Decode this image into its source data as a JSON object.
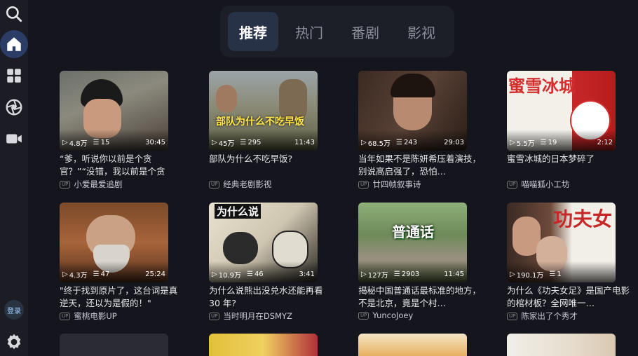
{
  "tabs": [
    {
      "label": "推荐",
      "active": true
    },
    {
      "label": "热门",
      "active": false
    },
    {
      "label": "番剧",
      "active": false
    },
    {
      "label": "影视",
      "active": false
    }
  ],
  "sidebar": {
    "login_label": "登录",
    "items": [
      "search-icon",
      "home-icon",
      "grid-icon",
      "aperture-icon",
      "video-icon"
    ]
  },
  "cards": [
    {
      "views": "4.8万",
      "danmaku": "15",
      "duration": "30:45",
      "title": "“爹，听说你以前是个贪官？”“没错，我以前是个贪官，…",
      "uploader": "小爱最爱追剧",
      "thumb_text": ""
    },
    {
      "views": "45万",
      "danmaku": "295",
      "duration": "11:43",
      "title": "部队为什么不吃早饭?",
      "uploader": "经典老剧影视",
      "thumb_text": "部队为什么不吃早饭"
    },
    {
      "views": "68.5万",
      "danmaku": "243",
      "duration": "29:03",
      "title": "当年如果不是陈妍希压着演技，别说高启强了，恐怕…",
      "uploader": "廿四帧叙事诗",
      "thumb_text": ""
    },
    {
      "views": "5.5万",
      "danmaku": "19",
      "duration": "2:12",
      "title": "蜜雪冰城的日本梦碎了",
      "uploader": "喵喵狐小工坊",
      "thumb_text": "蜜雪冰城"
    },
    {
      "views": "4.3万",
      "danmaku": "47",
      "duration": "25:24",
      "title": "\"终于找到原片了，这台词是真逆天，还以为是假的！\"",
      "uploader": "蜜桃电影UP",
      "thumb_text": ""
    },
    {
      "views": "10.9万",
      "danmaku": "46",
      "duration": "3:41",
      "title": "为什么说熊出没兑水还能再看 30 年?",
      "uploader": "当时明月在DSMYZ",
      "thumb_text": "为什么说"
    },
    {
      "views": "127万",
      "danmaku": "2903",
      "duration": "11:45",
      "title": "揭秘中国普通话最标准的地方，不是北京，竟是个村…",
      "uploader": "YuncoJoey",
      "thumb_text": "普通话"
    },
    {
      "views": "190.1万",
      "danmaku": "1",
      "duration": "",
      "title": "为什么《功夫女足》是国产电影的棺材板？全网唯一…",
      "uploader": "陈家出了个秀才",
      "thumb_text": "功夫女"
    }
  ]
}
